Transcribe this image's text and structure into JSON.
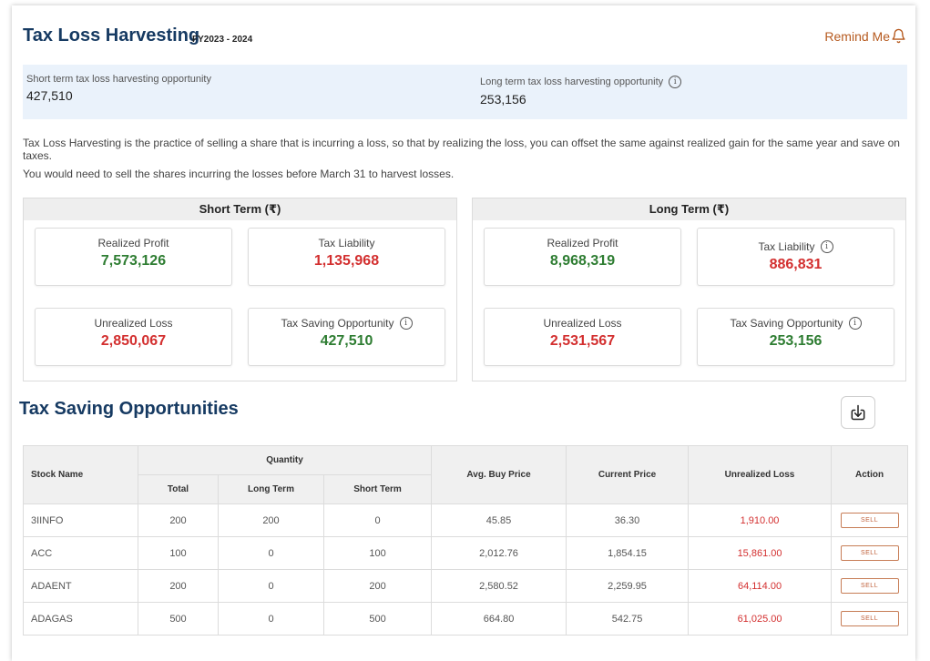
{
  "header": {
    "title": "Tax Loss Harvesting",
    "fy": "FY2023 - 2024",
    "remind_label": "Remind Me"
  },
  "summary": {
    "short_term_label": "Short term tax loss harvesting opportunity",
    "short_term_value": "427,510",
    "long_term_label": "Long term tax loss harvesting opportunity",
    "long_term_value": "253,156"
  },
  "info": {
    "paragraph1": "Tax Loss Harvesting is the practice of selling a share that is incurring a loss, so that by realizing the loss, you can offset the same against realized gain for the same year and save on taxes.",
    "paragraph2": "You would need to sell the shares incurring the losses before March 31 to harvest losses."
  },
  "short_term": {
    "title": "Short Term (₹)",
    "realized_profit_label": "Realized Profit",
    "realized_profit": "7,573,126",
    "tax_liability_label": "Tax Liability",
    "tax_liability": "1,135,968",
    "unrealized_loss_label": "Unrealized Loss",
    "unrealized_loss": "2,850,067",
    "tax_saving_label": "Tax Saving Opportunity",
    "tax_saving": "427,510"
  },
  "long_term": {
    "title": "Long Term (₹)",
    "realized_profit_label": "Realized Profit",
    "realized_profit": "8,968,319",
    "tax_liability_label": "Tax Liability",
    "tax_liability": "886,831",
    "unrealized_loss_label": "Unrealized Loss",
    "unrealized_loss": "2,531,567",
    "tax_saving_label": "Tax Saving Opportunity",
    "tax_saving": "253,156"
  },
  "opportunities": {
    "title": "Tax Saving Opportunities",
    "columns": {
      "stock_name": "Stock Name",
      "quantity": "Quantity",
      "total": "Total",
      "long_term": "Long Term",
      "short_term": "Short Term",
      "avg_buy_price": "Avg. Buy Price",
      "current_price": "Current Price",
      "unrealized_loss": "Unrealized Loss",
      "action": "Action"
    },
    "sell_label": "SELL",
    "rows": [
      {
        "stock": "3IINFO",
        "total": "200",
        "long": "200",
        "short": "0",
        "avg": "45.85",
        "current": "36.30",
        "loss": "1,910.00"
      },
      {
        "stock": "ACC",
        "total": "100",
        "long": "0",
        "short": "100",
        "avg": "2,012.76",
        "current": "1,854.15",
        "loss": "15,861.00"
      },
      {
        "stock": "ADAENT",
        "total": "200",
        "long": "0",
        "short": "200",
        "avg": "2,580.52",
        "current": "2,259.95",
        "loss": "64,114.00"
      },
      {
        "stock": "ADAGAS",
        "total": "500",
        "long": "0",
        "short": "500",
        "avg": "664.80",
        "current": "542.75",
        "loss": "61,025.00"
      }
    ]
  },
  "colors": {
    "title": "#163a62",
    "profit": "#2e7d32",
    "loss": "#d32f2f",
    "accent": "#b65a1f",
    "summary_bg": "#eaf2fb"
  }
}
